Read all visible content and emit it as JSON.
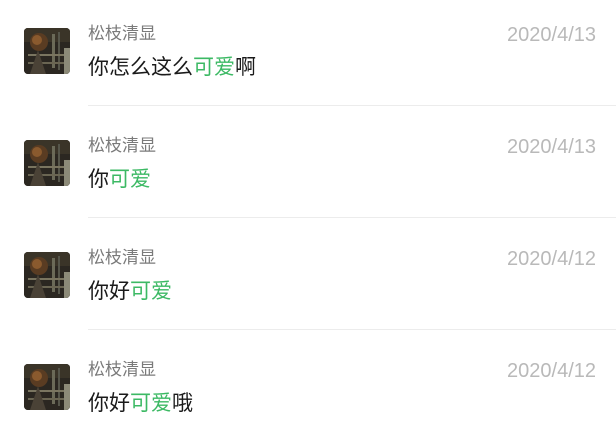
{
  "messages": [
    {
      "avatar_icon": "user-avatar-photo",
      "sender": "松枝清显",
      "text_before": "你怎么这么",
      "text_highlight": "可爱",
      "text_after": "啊",
      "date": "2020/4/13"
    },
    {
      "avatar_icon": "user-avatar-photo",
      "sender": "松枝清显",
      "text_before": "你",
      "text_highlight": "可爱",
      "text_after": "",
      "date": "2020/4/13"
    },
    {
      "avatar_icon": "user-avatar-photo",
      "sender": "松枝清显",
      "text_before": "你好",
      "text_highlight": "可爱",
      "text_after": "",
      "date": "2020/4/12"
    },
    {
      "avatar_icon": "user-avatar-photo",
      "sender": "松枝清显",
      "text_before": "你好",
      "text_highlight": "可爱",
      "text_after": "哦",
      "date": "2020/4/12"
    }
  ],
  "colors": {
    "highlight": "#3cb964",
    "sender": "#7a7a7a",
    "date": "#b9b9b9",
    "text": "#1a1a1a"
  }
}
